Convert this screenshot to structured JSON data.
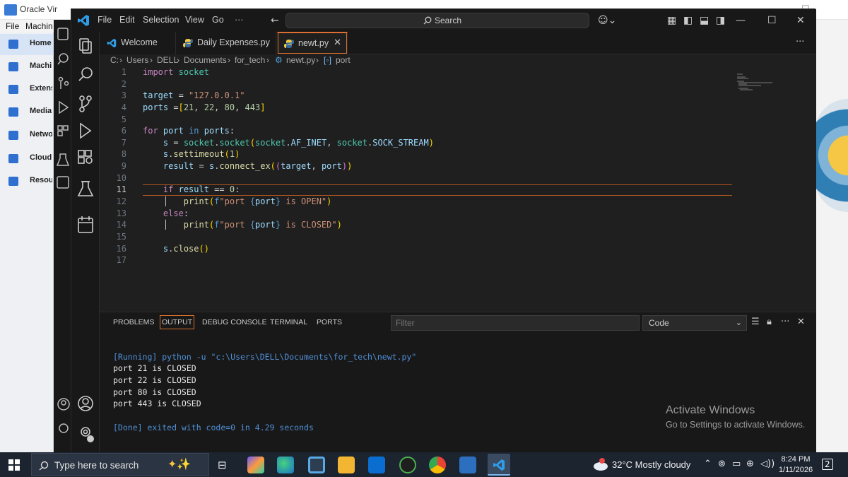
{
  "vbox": {
    "title": "Oracle Vir",
    "menu": [
      "File",
      "Machin"
    ],
    "sidebar": [
      "Home",
      "Machi",
      "Extens",
      "Media",
      "Netwo",
      "Cloud",
      "Resour"
    ]
  },
  "vscode": {
    "menu": [
      "File",
      "Edit",
      "Selection",
      "View",
      "Go",
      "···"
    ],
    "search_placeholder": "Search",
    "tabs": [
      {
        "label": "Welcome",
        "icon": "vscode-icon"
      },
      {
        "label": "Daily Expenses.py",
        "icon": "python-icon"
      },
      {
        "label": "newt.py",
        "icon": "python-icon",
        "active": true
      }
    ],
    "tabs_more": "···",
    "breadcrumb": [
      "C:",
      "Users",
      "DELL",
      "Documents",
      "for_tech",
      "newt.py",
      "port"
    ],
    "line_numbers": [
      "1",
      "2",
      "3",
      "4",
      "5",
      "6",
      "7",
      "8",
      "9",
      "10",
      "11",
      "12",
      "13",
      "14",
      "15",
      "16",
      "17"
    ],
    "current_line": "11",
    "panel": {
      "tabs": [
        "PROBLEMS",
        "OUTPUT",
        "DEBUG CONSOLE",
        "TERMINAL",
        "PORTS"
      ],
      "active_tab": "OUTPUT",
      "filter_placeholder": "Filter",
      "channel": "Code",
      "output": [
        "[Running] python -u \"c:\\Users\\DELL\\Documents\\for_tech\\newt.py\"",
        "port 21 is CLOSED",
        "port 22 is CLOSED",
        "port 80 is CLOSED",
        "port 443 is CLOSED",
        "",
        "[Done] exited with code=0 in 4.29 seconds"
      ]
    }
  },
  "watermark": {
    "title": "Activate Windows",
    "subtitle": "Go to Settings to activate Windows."
  },
  "taskbar": {
    "search_placeholder": "Type here to search",
    "weather": "32°C  Mostly cloudy",
    "time": "8:24 PM",
    "date": "1/11/2026",
    "notifications": "2"
  },
  "colors": {
    "accent": "#d7702e",
    "keyword": "#c586c0",
    "string": "#ce9178",
    "number": "#b5cea8",
    "output_blue": "#4f8fd6"
  }
}
